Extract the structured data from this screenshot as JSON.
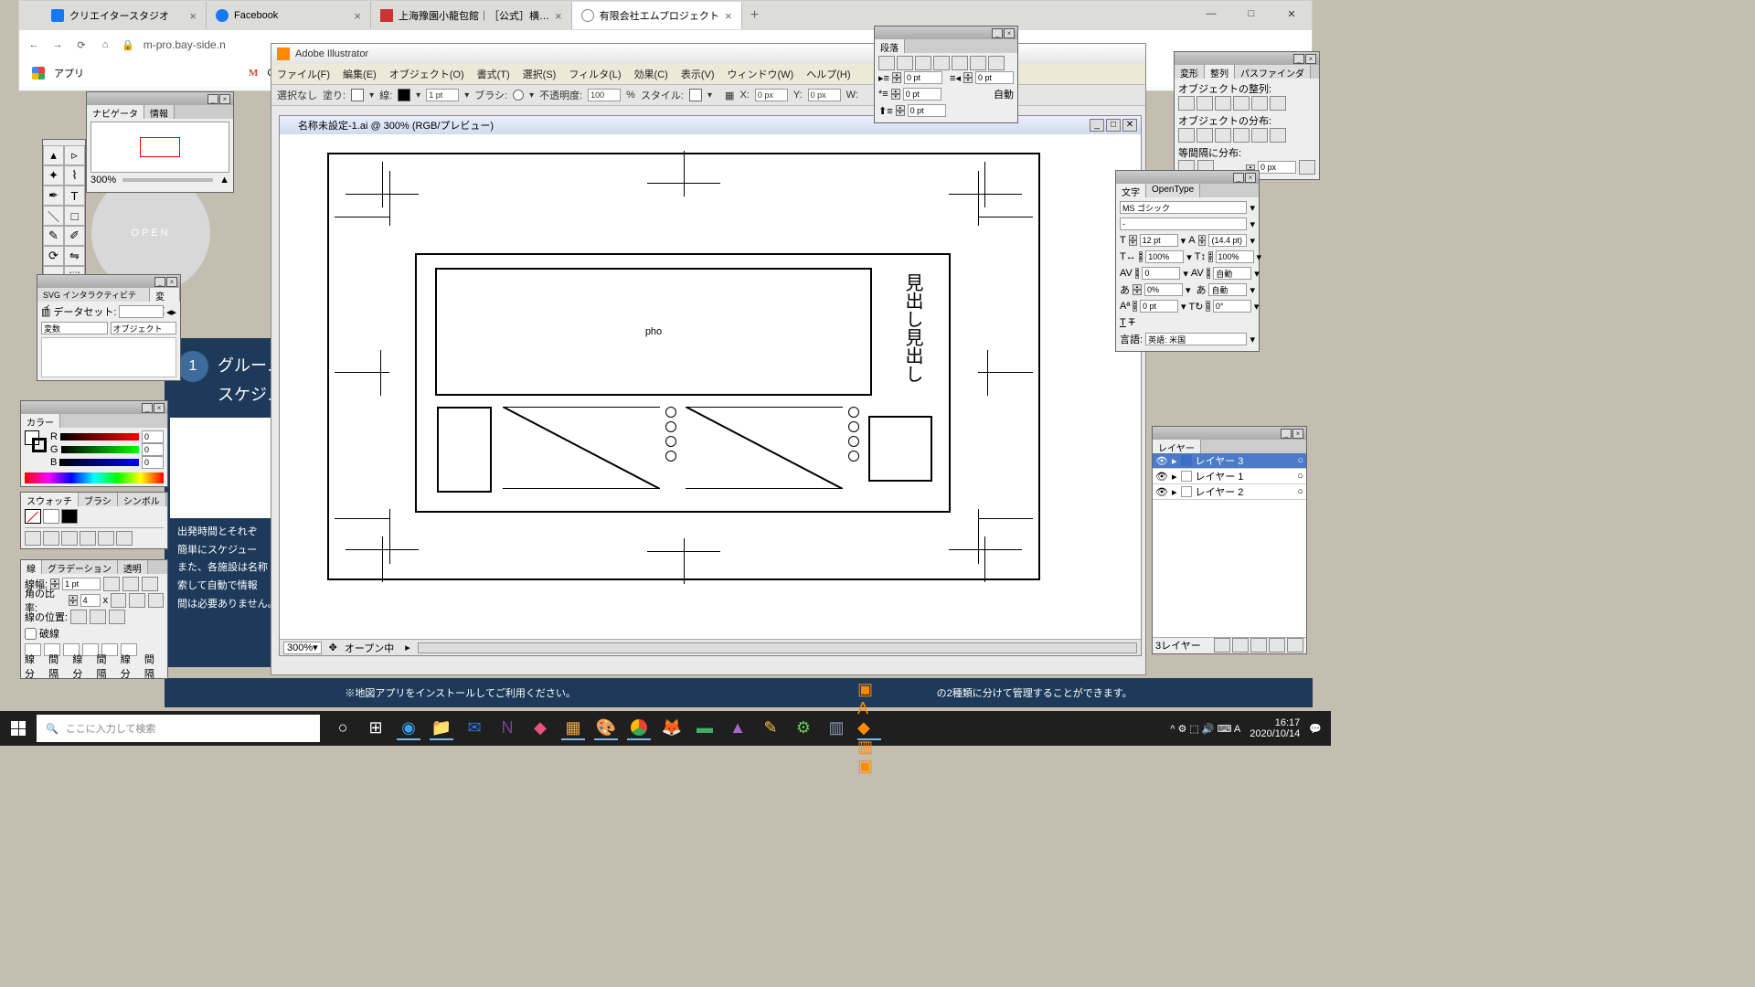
{
  "browser": {
    "tabs": [
      {
        "label": "クリエイタースタジオ",
        "icon_color": "#1877f2"
      },
      {
        "label": "Facebook",
        "icon_color": "#1877f2"
      },
      {
        "label": "上海豫園小龍包館｜［公式］横…",
        "icon_color": "#c33"
      },
      {
        "label": "有限会社エムプロジェクト",
        "icon_color": "#888"
      }
    ],
    "url": "m-pro.bay-side.n",
    "apps_label": "アプリ",
    "gmail_short": "Gm"
  },
  "win_controls": {
    "min": "—",
    "max": "□",
    "close": "✕"
  },
  "illustrator": {
    "title": "Adobe Illustrator",
    "menu": [
      "ファイル(F)",
      "編集(E)",
      "オブジェクト(O)",
      "書式(T)",
      "選択(S)",
      "フィルタ(L)",
      "効果(C)",
      "表示(V)",
      "ウィンドウ(W)",
      "ヘルプ(H)"
    ],
    "control_bar": {
      "no_selection": "選択なし",
      "fill_label": "塗り:",
      "stroke_label": "線:",
      "stroke_pt": "1 pt",
      "brush_label": "ブラシ:",
      "opacity_label": "不透明度:",
      "opacity_val": "100",
      "opacity_pct": "%",
      "style_label": "スタイル:",
      "x_label": "X:",
      "x_val": "0 px",
      "y_label": "Y:",
      "y_val": "0 px",
      "w_label": "W:"
    },
    "doc_title": "名称未設定-1.ai @ 300% (RGB/プレビュー)",
    "canvas": {
      "pho": "pho",
      "vtext": "見出し見出し"
    },
    "status": {
      "zoom": "300%",
      "mode": "オープン中"
    }
  },
  "panels": {
    "navigator": {
      "tabs": [
        "ナビゲータ",
        "情報"
      ],
      "zoom": "300%"
    },
    "svg": {
      "tabs": [
        "SVG インタラクティビティ",
        "変数"
      ],
      "dataset_label": "データセット:",
      "btn_var": "変数",
      "btn_obj": "オブジェクト"
    },
    "color": {
      "tab": "カラー",
      "r": "R",
      "g": "G",
      "b": "B",
      "r_val": "0",
      "g_val": "0",
      "b_val": "0"
    },
    "swatch_tabs": [
      "スウォッチ",
      "ブラシ",
      "シンボル"
    ],
    "stroke": {
      "tabs": [
        "線",
        "グラデーション",
        "透明"
      ],
      "weight_label": "線幅:",
      "weight_val": "1 pt",
      "miter_label": "角の比率:",
      "miter_val": "4",
      "miter_x": "x",
      "align_label": "線の位置:",
      "dashed_label": "破線",
      "dash_labels": [
        "線分",
        "間隔",
        "線分",
        "間隔",
        "線分",
        "間隔"
      ]
    },
    "paragraph": {
      "tab": "段落",
      "indent_left": "0 pt",
      "indent_right": "0 pt",
      "indent_first": "0 pt",
      "auto": "自動"
    },
    "align": {
      "tabs": [
        "変形",
        "整列",
        "パスファインダ"
      ],
      "obj_align": "オブジェクトの整列:",
      "obj_dist": "オブジェクトの分布:",
      "space_dist": "等間隔に分布:",
      "gap": "0 px"
    },
    "character": {
      "tabs": [
        "文字",
        "OpenType"
      ],
      "font": "MS ゴシック",
      "style": "-",
      "size": "12 pt",
      "leading": "(14.4 pt)",
      "hscale": "100%",
      "vscale": "100%",
      "tracking": "0",
      "kerning": "自動",
      "baseline": "0%",
      "tsume": "自動",
      "shift": "0 pt",
      "rotate": "0°",
      "lang_label": "言語:",
      "lang": "英語: 米国"
    },
    "layers": {
      "tab": "レイヤー",
      "rows": [
        {
          "name": "レイヤー 3",
          "color": "#3b6fc7",
          "selected": true
        },
        {
          "name": "レイヤー 1",
          "color": "#d94",
          "selected": false
        },
        {
          "name": "レイヤー 2",
          "color": "#7cc",
          "selected": false
        }
      ],
      "footer": "3レイヤー"
    }
  },
  "web_bg": {
    "heading1": "グルー…",
    "heading2": "スケジ…",
    "body": "出発時間とそれぞ\n簡単にスケジュー\nまた、各施設は名称\n索して自動で情報\n間は必要ありません。",
    "strip_mid": "※地図アプリをインストールしてご利用ください。",
    "strip_right": "の2種類に分けて管理することができます。",
    "open": "OPEN"
  },
  "taskbar": {
    "search_placeholder": "ここに入力して検索",
    "systray_icons": "^ ⚙ ⬚ 🔊 ⌨ A",
    "time": "16:17",
    "date": "2020/10/14"
  }
}
